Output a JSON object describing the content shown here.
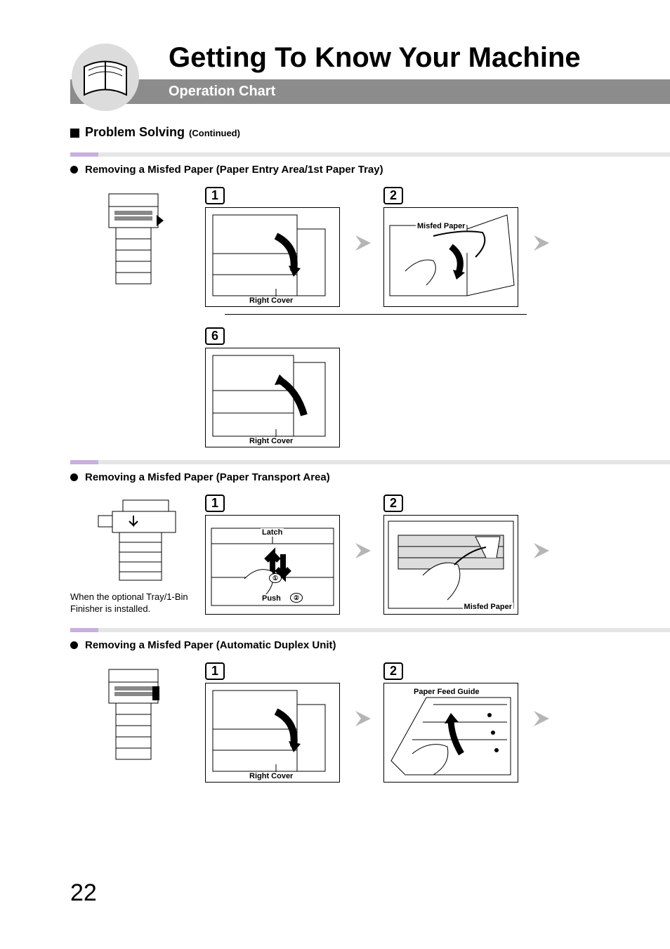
{
  "header": {
    "title": "Getting To Know Your Machine",
    "subtitle": "Operation Chart"
  },
  "section": {
    "heading": "Problem Solving",
    "continued": "(Continued)"
  },
  "procedures": [
    {
      "title": "Removing a Misfed Paper (Paper Entry Area/1st Paper Tray)",
      "intro_note": "",
      "row1": [
        {
          "num": "1",
          "labels": [
            {
              "text": "Right Cover",
              "pos": "bottom"
            }
          ]
        },
        {
          "num": "2",
          "labels": [
            {
              "text": "Misfed Paper",
              "pos": "top"
            }
          ]
        }
      ],
      "row2": [
        {
          "num": "6",
          "labels": [
            {
              "text": "Right Cover",
              "pos": "bottom"
            }
          ]
        }
      ]
    },
    {
      "title": "Removing a Misfed Paper (Paper Transport Area)",
      "intro_note": "When the optional Tray/1-Bin Finisher is installed.",
      "row1": [
        {
          "num": "1",
          "labels": [
            {
              "text": "Latch",
              "pos": "top-center"
            },
            {
              "text": "Push",
              "pos": "bottom-center"
            },
            {
              "text": "①",
              "pos": "c1"
            },
            {
              "text": "②",
              "pos": "c2"
            }
          ]
        },
        {
          "num": "2",
          "labels": [
            {
              "text": "Misfed Paper",
              "pos": "bottom-right"
            }
          ]
        }
      ]
    },
    {
      "title": "Removing a Misfed Paper (Automatic Duplex Unit)",
      "intro_note": "",
      "row1": [
        {
          "num": "1",
          "labels": [
            {
              "text": "Right Cover",
              "pos": "bottom"
            }
          ]
        },
        {
          "num": "2",
          "labels": [
            {
              "text": "Paper Feed Guide",
              "pos": "top"
            }
          ]
        }
      ]
    }
  ],
  "page_number": "22"
}
